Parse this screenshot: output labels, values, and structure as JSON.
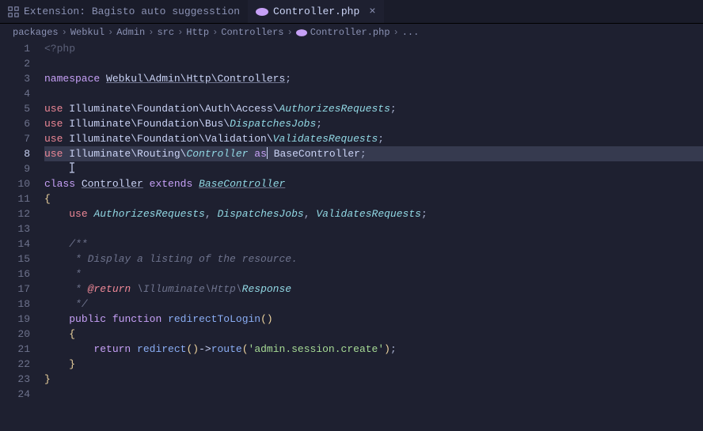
{
  "tabs": [
    {
      "label": "Extension: Bagisto auto suggesstion",
      "active": false,
      "iconType": "grid"
    },
    {
      "label": "Controller.php",
      "active": true,
      "iconType": "php"
    }
  ],
  "breadcrumbs": {
    "segments": [
      "packages",
      "Webkul",
      "Admin",
      "src",
      "Http",
      "Controllers",
      "Controller.php"
    ],
    "trailing": "..."
  },
  "lines": [
    "1",
    "2",
    "3",
    "4",
    "5",
    "6",
    "7",
    "8",
    "9",
    "10",
    "11",
    "12",
    "13",
    "14",
    "15",
    "16",
    "17",
    "18",
    "19",
    "20",
    "21",
    "22",
    "23",
    "24"
  ],
  "code": {
    "l1": {
      "open": "<?php"
    },
    "l3": {
      "namespace": "namespace",
      "path": "Webkul\\Admin\\Http\\Controllers"
    },
    "l5": {
      "use": "use",
      "path": "Illuminate\\Foundation\\Auth\\Access\\",
      "cls": "AuthorizesRequests"
    },
    "l6": {
      "use": "use",
      "path": "Illuminate\\Foundation\\Bus\\",
      "cls": "DispatchesJobs"
    },
    "l7": {
      "use": "use",
      "path": "Illuminate\\Foundation\\Validation\\",
      "cls": "ValidatesRequests"
    },
    "l8": {
      "use": "use",
      "path": "Illuminate\\Routing\\",
      "cls": "Controller",
      "as": "as",
      "alias": "BaseController"
    },
    "l10": {
      "class": "class",
      "name": "Controller",
      "extends": "extends",
      "base": "BaseController"
    },
    "l11": {
      "brace": "{"
    },
    "l12": {
      "use": "use",
      "t1": "AuthorizesRequests",
      "t2": "DispatchesJobs",
      "t3": "ValidatesRequests"
    },
    "l14": {
      "c": "/**"
    },
    "l15": {
      "c": " * Display a listing of the resource."
    },
    "l16": {
      "c": " *"
    },
    "l17": {
      "c1": " * ",
      "tag": "@return",
      "c2": " \\Illuminate\\Http\\",
      "cls": "Response"
    },
    "l18": {
      "c": " */"
    },
    "l19": {
      "public": "public",
      "function": "function",
      "name": "redirectToLogin"
    },
    "l20": {
      "brace": "{"
    },
    "l21": {
      "return": "return",
      "fn1": "redirect",
      "fn2": "route",
      "str": "'admin.session.create'"
    },
    "l22": {
      "brace": "}"
    },
    "l23": {
      "brace": "}"
    }
  }
}
